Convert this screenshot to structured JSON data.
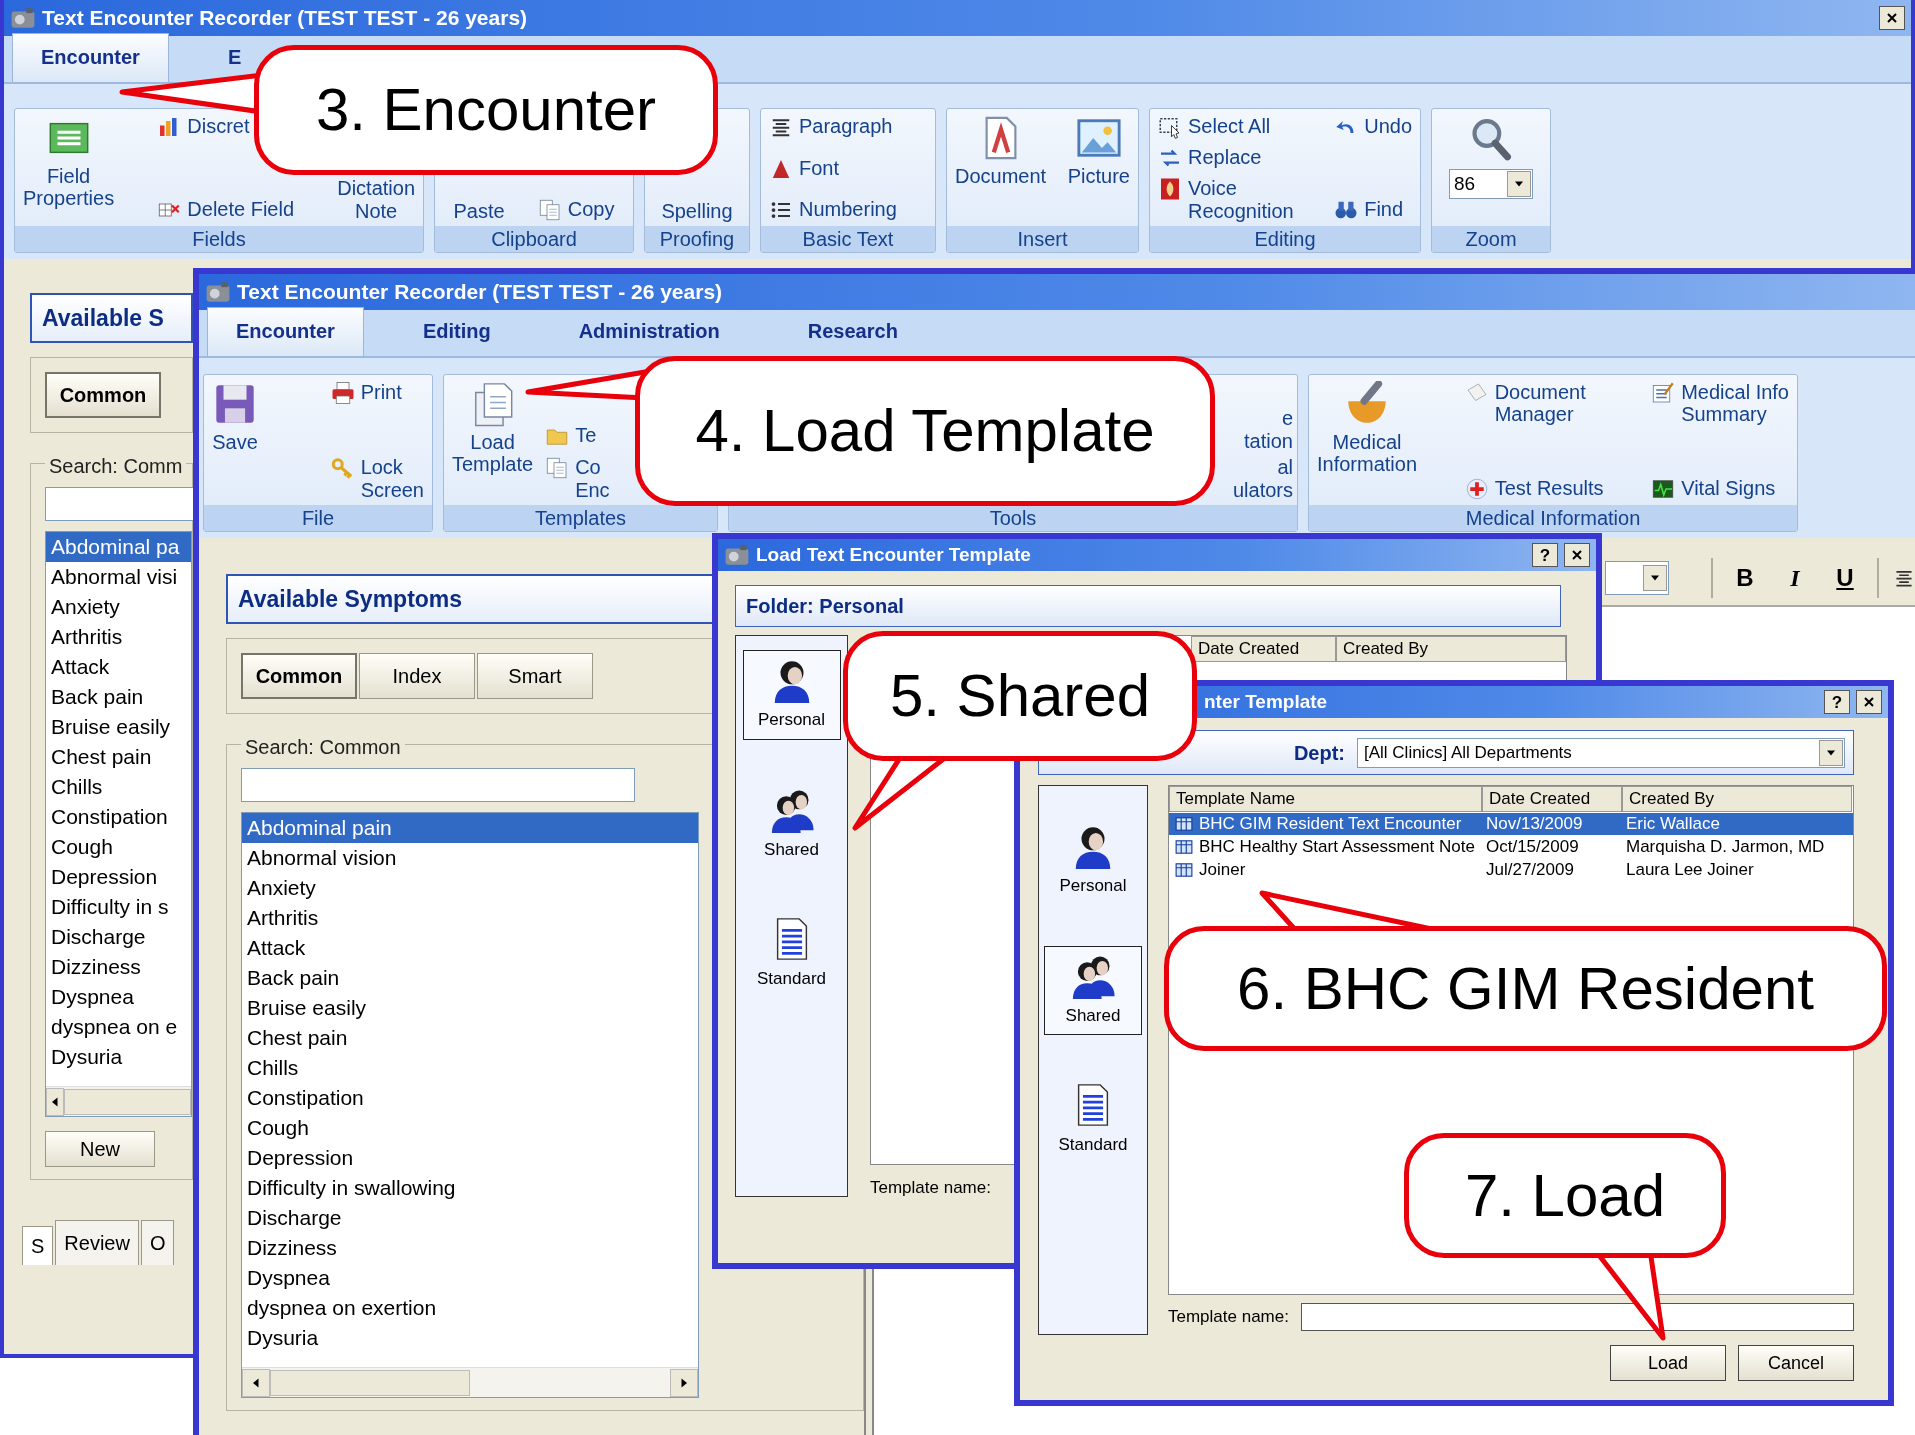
{
  "back_window": {
    "title": "Text Encounter Recorder (TEST TEST - 26 years)",
    "tabs": [
      {
        "label": "Encounter",
        "selected": true
      },
      {
        "label": "E",
        "selected": false
      }
    ],
    "ribbon_groups": [
      {
        "label": "Fields",
        "columns": [
          {
            "items": [
              {
                "kind": "large",
                "lines": [
                  "Field",
                  "Properties"
                ]
              }
            ]
          },
          {
            "items": [
              {
                "kind": "small",
                "lines": [
                  "Discret"
                ]
              },
              {
                "kind": "small",
                "lines": [
                  "Delete Field"
                ]
              }
            ]
          },
          {
            "items": [
              {
                "kind": "text",
                "lines": [
                  "Dictation",
                  "Note"
                ]
              }
            ]
          }
        ]
      },
      {
        "label": "Clipboard",
        "columns": [
          {
            "items": [
              {
                "kind": "text",
                "lines": [
                  "Paste"
                ]
              }
            ]
          },
          {
            "items": [
              {
                "kind": "small",
                "lines": [
                  "Copy"
                ]
              }
            ]
          }
        ]
      },
      {
        "label": "Proofing",
        "columns": [
          {
            "items": [
              {
                "kind": "text",
                "lines": [
                  "Spelling"
                ]
              }
            ]
          }
        ]
      },
      {
        "label": "Basic Text",
        "columns": [
          {
            "items": [
              {
                "kind": "small",
                "lines": [
                  "Paragraph"
                ]
              },
              {
                "kind": "small",
                "lines": [
                  "Font"
                ]
              },
              {
                "kind": "small",
                "lines": [
                  "Numbering"
                ]
              }
            ]
          }
        ]
      },
      {
        "label": "Insert",
        "columns": [
          {
            "items": [
              {
                "kind": "large",
                "lines": [
                  "Document"
                ]
              }
            ]
          },
          {
            "items": [
              {
                "kind": "large",
                "lines": [
                  "Picture"
                ]
              }
            ]
          }
        ]
      },
      {
        "label": "Editing",
        "columns": [
          {
            "items": [
              {
                "kind": "small",
                "lines": [
                  "Select All"
                ]
              },
              {
                "kind": "small",
                "lines": [
                  "Replace"
                ]
              },
              {
                "kind": "small",
                "lines": [
                  "Voice Recognition"
                ]
              }
            ]
          },
          {
            "items": [
              {
                "kind": "small",
                "lines": [
                  "Undo"
                ]
              },
              {
                "kind": "small",
                "lines": [
                  "Find"
                ]
              }
            ]
          }
        ]
      },
      {
        "label": "Zoom",
        "columns": [
          {
            "items": [
              {
                "kind": "combo",
                "value": "86"
              }
            ]
          }
        ]
      }
    ],
    "side_panel": {
      "heading": "Available S",
      "filter_buttons": [
        {
          "label": "Common",
          "selected": true
        }
      ],
      "search_label": "Search: Comm",
      "symptoms": [
        {
          "label": "Abdominal pa",
          "selected": true
        },
        {
          "label": "Abnormal visi",
          "selected": false
        },
        {
          "label": "Anxiety",
          "selected": false
        },
        {
          "label": "Arthritis",
          "selected": false
        },
        {
          "label": "Attack",
          "selected": false
        },
        {
          "label": "Back pain",
          "selected": false
        },
        {
          "label": "Bruise easily",
          "selected": false
        },
        {
          "label": "Chest pain",
          "selected": false
        },
        {
          "label": "Chills",
          "selected": false
        },
        {
          "label": "Constipation",
          "selected": false
        },
        {
          "label": "Cough",
          "selected": false
        },
        {
          "label": "Depression",
          "selected": false
        },
        {
          "label": "Difficulty in s",
          "selected": false
        },
        {
          "label": "Discharge",
          "selected": false
        },
        {
          "label": "Dizziness",
          "selected": false
        },
        {
          "label": "Dyspnea",
          "selected": false
        },
        {
          "label": "dyspnea on e",
          "selected": false
        },
        {
          "label": "Dysuria",
          "selected": false
        }
      ],
      "buttons": [
        "New"
      ],
      "bottom_tabs": [
        {
          "label": "S",
          "selected": true
        },
        {
          "label": "Review",
          "selected": false
        },
        {
          "label": "O",
          "selected": false
        }
      ]
    }
  },
  "main_window": {
    "title": "Text Encounter Recorder (TEST TEST - 26 years)",
    "tabs": [
      {
        "label": "Encounter",
        "selected": true
      },
      {
        "label": "Editing",
        "selected": false
      },
      {
        "label": "Administration",
        "selected": false
      },
      {
        "label": "Research",
        "selected": false
      }
    ],
    "ribbon_groups": [
      {
        "label": "File",
        "columns": [
          {
            "items": [
              {
                "kind": "large",
                "lines": [
                  "Save"
                ]
              }
            ]
          },
          {
            "items": [
              {
                "kind": "small",
                "lines": [
                  "Print"
                ]
              },
              {
                "kind": "small",
                "lines": [
                  "Lock",
                  "Screen"
                ]
              }
            ]
          }
        ]
      },
      {
        "label": "Templates",
        "columns": [
          {
            "items": [
              {
                "kind": "large",
                "lines": [
                  "Load",
                  "Template"
                ]
              }
            ]
          },
          {
            "items": [
              {
                "kind": "small",
                "lines": [
                  "Te"
                ]
              },
              {
                "kind": "small",
                "lines": [
                  "Co",
                  "Enc"
                ]
              }
            ]
          }
        ]
      },
      {
        "label": "Tools",
        "columns": [
          {
            "items": [
              {
                "kind": "text",
                "lines": [
                  "e",
                  "tation"
                ]
              },
              {
                "kind": "text",
                "lines": [
                  "al",
                  "ulators"
                ]
              }
            ]
          }
        ]
      },
      {
        "label": "Medical Information",
        "columns": [
          {
            "items": [
              {
                "kind": "large",
                "lines": [
                  "Medical",
                  "Information"
                ]
              }
            ]
          },
          {
            "items": [
              {
                "kind": "small",
                "lines": [
                  "Document",
                  "Manager"
                ]
              },
              {
                "kind": "small",
                "lines": [
                  "Test Results"
                ]
              }
            ]
          },
          {
            "items": [
              {
                "kind": "small",
                "lines": [
                  "Medical Info",
                  "Summary"
                ]
              },
              {
                "kind": "small",
                "lines": [
                  "Vital Signs"
                ]
              }
            ]
          }
        ]
      }
    ],
    "symptoms_panel": {
      "heading": "Available Symptoms",
      "filter_buttons": [
        {
          "label": "Common",
          "selected": true
        },
        {
          "label": "Index",
          "selected": false
        },
        {
          "label": "Smart",
          "selected": false
        }
      ],
      "search_label": "Search: Common",
      "symptoms": [
        {
          "label": "Abdominal pain",
          "selected": true
        },
        {
          "label": "Abnormal vision",
          "selected": false
        },
        {
          "label": "Anxiety",
          "selected": false
        },
        {
          "label": "Arthritis",
          "selected": false
        },
        {
          "label": "Attack",
          "selected": false
        },
        {
          "label": "Back pain",
          "selected": false
        },
        {
          "label": "Bruise easily",
          "selected": false
        },
        {
          "label": "Chest pain",
          "selected": false
        },
        {
          "label": "Chills",
          "selected": false
        },
        {
          "label": "Constipation",
          "selected": false
        },
        {
          "label": "Cough",
          "selected": false
        },
        {
          "label": "Depression",
          "selected": false
        },
        {
          "label": "Difficulty in swallowing",
          "selected": false
        },
        {
          "label": "Discharge",
          "selected": false
        },
        {
          "label": "Dizziness",
          "selected": false
        },
        {
          "label": "Dyspnea",
          "selected": false
        },
        {
          "label": "dyspnea on exertion",
          "selected": false
        },
        {
          "label": "Dysuria",
          "selected": false
        }
      ]
    },
    "editor_toolbar": [
      {
        "kind": "bold",
        "label": "B"
      },
      {
        "kind": "italic",
        "label": "I"
      },
      {
        "kind": "underline",
        "label": "U"
      }
    ]
  },
  "template_dialog_back": {
    "title": "Load Text Encounter Template",
    "help_button": "?",
    "folder": "Folder: Personal",
    "folders": [
      {
        "label": "Personal",
        "selected": true
      },
      {
        "label": "Shared",
        "selected": false
      },
      {
        "label": "Standard",
        "selected": false
      }
    ],
    "columns": [
      "Date Created",
      "Created By"
    ],
    "template_name_label": "Template name:"
  },
  "template_dialog_front": {
    "title": "nter Template",
    "help_button": "?",
    "dept_label": "Dept:",
    "dept_value": "[All Clinics] All Departments",
    "folders": [
      {
        "label": "Personal",
        "selected": false
      },
      {
        "label": "Shared",
        "selected": true
      },
      {
        "label": "Standard",
        "selected": false
      }
    ],
    "columns": [
      "Template Name",
      "Date Created",
      "Created By"
    ],
    "rows": [
      {
        "cells": [
          "BHC GIM Resident Text Encounter",
          "Nov/13/2009",
          "Eric Wallace"
        ],
        "selected": true
      },
      {
        "cells": [
          "BHC Healthy Start Assessment Note",
          "Oct/15/2009",
          "Marquisha D. Jarmon, MD"
        ],
        "selected": false
      },
      {
        "cells": [
          "Joiner",
          "Jul/27/2009",
          "Laura Lee Joiner"
        ],
        "selected": false
      }
    ],
    "template_name_label": "Template name:",
    "buttons": [
      "Load",
      "Cancel"
    ]
  },
  "callouts": [
    {
      "text": "3. Encounter"
    },
    {
      "text": "4. Load Template"
    },
    {
      "text": "5. Shared"
    },
    {
      "text": "6. BHC GIM Resident"
    },
    {
      "text": "7. Load"
    }
  ]
}
